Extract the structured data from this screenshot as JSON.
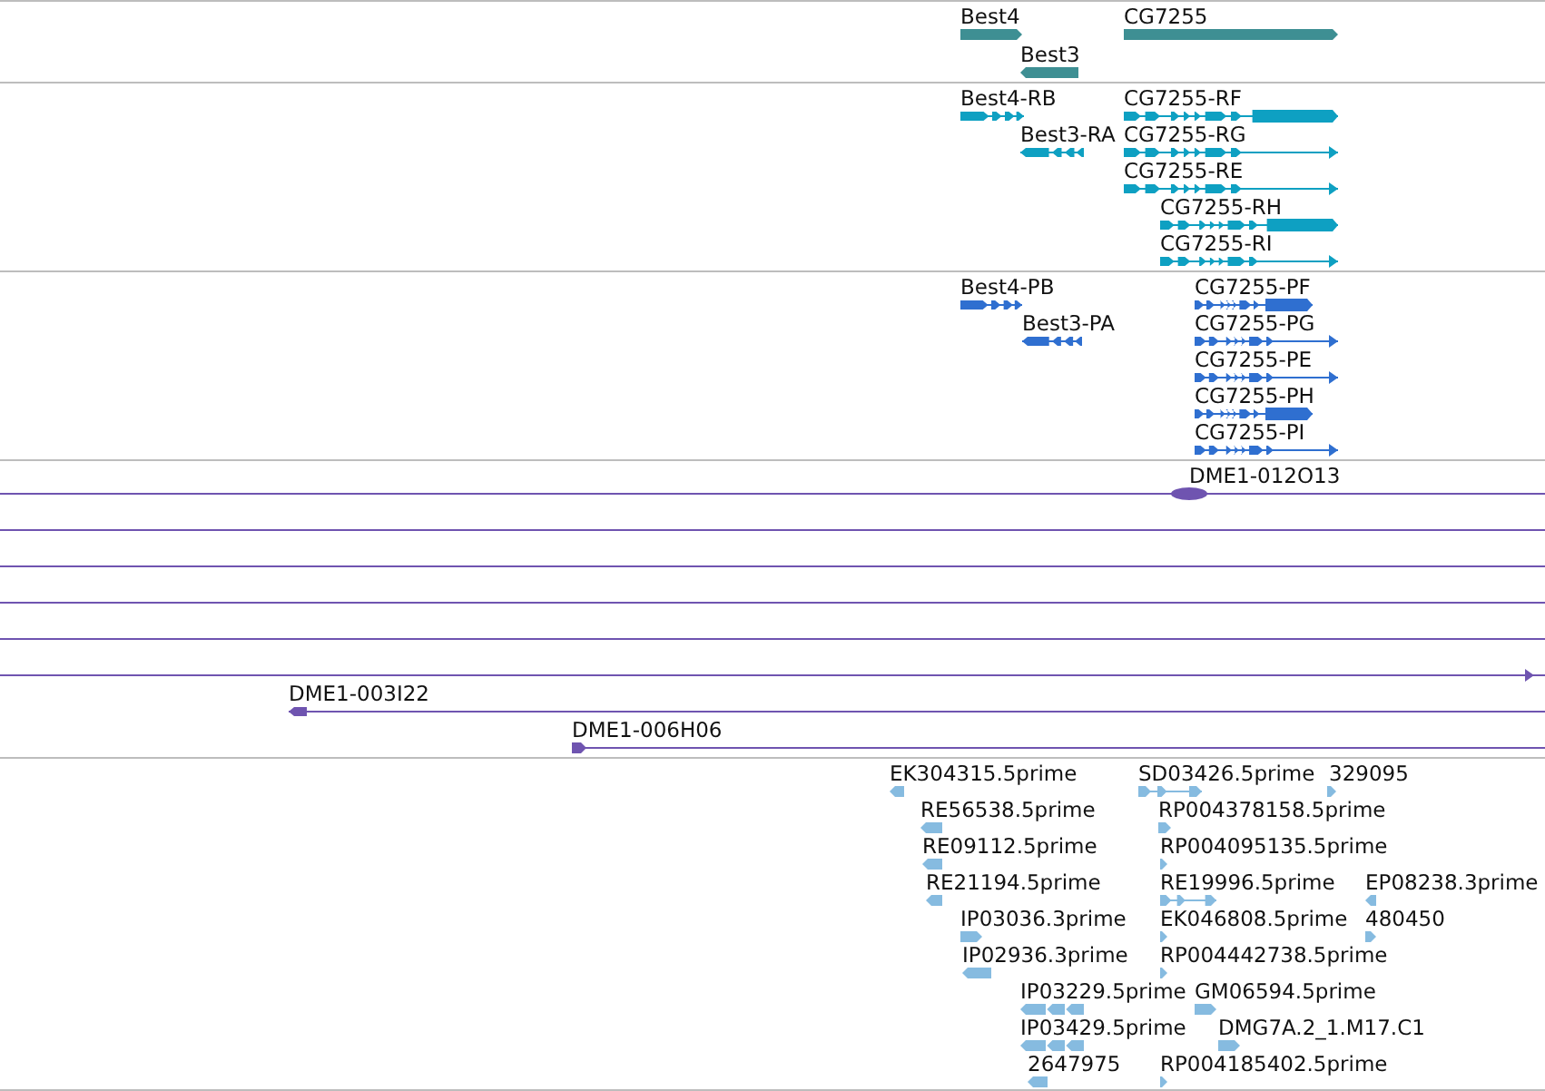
{
  "tracks": [
    {
      "kind": "gene",
      "color": "#3e8f93",
      "features": [
        {
          "label": "Best4",
          "reverse": false
        },
        {
          "label": "Best3",
          "reverse": true
        },
        {
          "label": "CG7255",
          "reverse": false
        }
      ]
    },
    {
      "kind": "transcript",
      "color": "#0ea0c2",
      "features": [
        {
          "label": "Best4-RB",
          "reverse": false
        },
        {
          "label": "Best3-RA",
          "reverse": true
        },
        {
          "label": "CG7255-RF",
          "reverse": false
        },
        {
          "label": "CG7255-RG",
          "reverse": false
        },
        {
          "label": "CG7255-RE",
          "reverse": false
        },
        {
          "label": "CG7255-RH",
          "reverse": false
        },
        {
          "label": "CG7255-RI",
          "reverse": false
        }
      ]
    },
    {
      "kind": "protein",
      "color": "#2f6fd0",
      "features": [
        {
          "label": "Best4-PB",
          "reverse": false
        },
        {
          "label": "Best3-PA",
          "reverse": true
        },
        {
          "label": "CG7255-PF",
          "reverse": false
        },
        {
          "label": "CG7255-PG",
          "reverse": false
        },
        {
          "label": "CG7255-PE",
          "reverse": false
        },
        {
          "label": "CG7255-PH",
          "reverse": false
        },
        {
          "label": "CG7255-PI",
          "reverse": false
        }
      ]
    },
    {
      "kind": "clone",
      "color": "#6f54b0",
      "features": [
        {
          "kind": "clone",
          "label": "DME1-012O13"
        },
        {
          "kind": "line"
        },
        {
          "kind": "line"
        },
        {
          "kind": "line"
        },
        {
          "kind": "line"
        },
        {
          "kind": "clone",
          "reverse": false
        },
        {
          "kind": "clone",
          "label": "DME1-003I22",
          "reverse": true
        },
        {
          "kind": "clone",
          "label": "DME1-006H06",
          "reverse": false
        }
      ]
    },
    {
      "kind": "est",
      "color": "#86bbe0",
      "features": [
        {
          "label": "EK304315.5prime",
          "reverse": true
        },
        {
          "label": "SD03426.5prime",
          "reverse": false
        },
        {
          "label": "329095",
          "reverse": false
        },
        {
          "label": "RE56538.5prime",
          "reverse": true
        },
        {
          "label": "RP004378158.5prime",
          "reverse": false
        },
        {
          "label": "RE09112.5prime",
          "reverse": true
        },
        {
          "label": "RP004095135.5prime",
          "reverse": false
        },
        {
          "label": "RE21194.5prime",
          "reverse": true
        },
        {
          "label": "RE19996.5prime",
          "reverse": false
        },
        {
          "label": "EP08238.3prime",
          "reverse": true
        },
        {
          "label": "IP03036.3prime",
          "reverse": false
        },
        {
          "label": "EK046808.5prime",
          "reverse": false
        },
        {
          "label": "480450",
          "reverse": false
        },
        {
          "label": "IP02936.3prime",
          "reverse": true
        },
        {
          "label": "RP004442738.5prime",
          "reverse": false
        },
        {
          "label": "IP03229.5prime",
          "reverse": true
        },
        {
          "label": "GM06594.5prime",
          "reverse": false
        },
        {
          "label": "IP03429.5prime",
          "reverse": true
        },
        {
          "label": "DMG7A.2_1.M17.C1",
          "reverse": false
        },
        {
          "label": "2647975",
          "reverse": true
        },
        {
          "label": "RP004185402.5prime",
          "reverse": false
        }
      ]
    }
  ]
}
